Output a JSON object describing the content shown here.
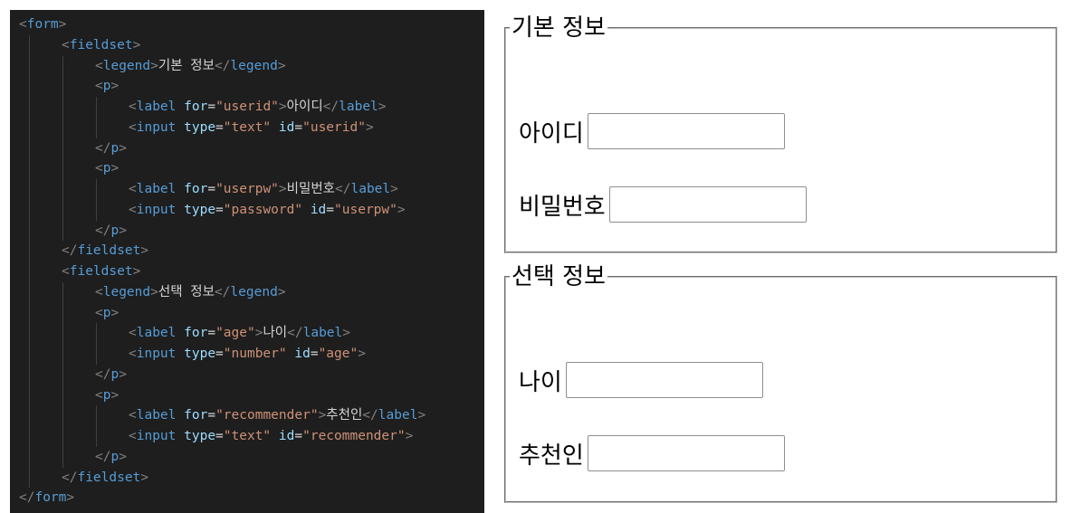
{
  "code": {
    "lines": [
      {
        "indent": 0,
        "segments": [
          {
            "cls": "p",
            "text": "<"
          },
          {
            "cls": "t",
            "text": "form"
          },
          {
            "cls": "p",
            "text": ">"
          }
        ]
      },
      {
        "indent": 1,
        "segments": [
          {
            "cls": "p",
            "text": "<"
          },
          {
            "cls": "t",
            "text": "fieldset"
          },
          {
            "cls": "p",
            "text": ">"
          }
        ]
      },
      {
        "indent": 2,
        "segments": [
          {
            "cls": "p",
            "text": "<"
          },
          {
            "cls": "t",
            "text": "legend"
          },
          {
            "cls": "p",
            "text": ">"
          },
          {
            "cls": "c",
            "text": "기본 정보"
          },
          {
            "cls": "p",
            "text": "</"
          },
          {
            "cls": "t",
            "text": "legend"
          },
          {
            "cls": "p",
            "text": ">"
          }
        ]
      },
      {
        "indent": 2,
        "segments": [
          {
            "cls": "p",
            "text": "<"
          },
          {
            "cls": "t",
            "text": "p"
          },
          {
            "cls": "p",
            "text": ">"
          }
        ]
      },
      {
        "indent": 3,
        "segments": [
          {
            "cls": "p",
            "text": "<"
          },
          {
            "cls": "t",
            "text": "label"
          },
          {
            "cls": "c",
            "text": " "
          },
          {
            "cls": "a",
            "text": "for"
          },
          {
            "cls": "c",
            "text": "="
          },
          {
            "cls": "s",
            "text": "\"userid\""
          },
          {
            "cls": "p",
            "text": ">"
          },
          {
            "cls": "c",
            "text": "아이디"
          },
          {
            "cls": "p",
            "text": "</"
          },
          {
            "cls": "t",
            "text": "label"
          },
          {
            "cls": "p",
            "text": ">"
          }
        ]
      },
      {
        "indent": 3,
        "segments": [
          {
            "cls": "p",
            "text": "<"
          },
          {
            "cls": "t",
            "text": "input"
          },
          {
            "cls": "c",
            "text": " "
          },
          {
            "cls": "a",
            "text": "type"
          },
          {
            "cls": "c",
            "text": "="
          },
          {
            "cls": "s",
            "text": "\"text\""
          },
          {
            "cls": "c",
            "text": " "
          },
          {
            "cls": "a",
            "text": "id"
          },
          {
            "cls": "c",
            "text": "="
          },
          {
            "cls": "s",
            "text": "\"userid\""
          },
          {
            "cls": "p",
            "text": ">"
          }
        ]
      },
      {
        "indent": 2,
        "segments": [
          {
            "cls": "p",
            "text": "</"
          },
          {
            "cls": "t",
            "text": "p"
          },
          {
            "cls": "p",
            "text": ">"
          }
        ]
      },
      {
        "indent": 2,
        "segments": [
          {
            "cls": "p",
            "text": "<"
          },
          {
            "cls": "t",
            "text": "p"
          },
          {
            "cls": "p",
            "text": ">"
          }
        ]
      },
      {
        "indent": 3,
        "segments": [
          {
            "cls": "p",
            "text": "<"
          },
          {
            "cls": "t",
            "text": "label"
          },
          {
            "cls": "c",
            "text": " "
          },
          {
            "cls": "a",
            "text": "for"
          },
          {
            "cls": "c",
            "text": "="
          },
          {
            "cls": "s",
            "text": "\"userpw\""
          },
          {
            "cls": "p",
            "text": ">"
          },
          {
            "cls": "c",
            "text": "비밀번호"
          },
          {
            "cls": "p",
            "text": "</"
          },
          {
            "cls": "t",
            "text": "label"
          },
          {
            "cls": "p",
            "text": ">"
          }
        ]
      },
      {
        "indent": 3,
        "segments": [
          {
            "cls": "p",
            "text": "<"
          },
          {
            "cls": "t",
            "text": "input"
          },
          {
            "cls": "c",
            "text": " "
          },
          {
            "cls": "a",
            "text": "type"
          },
          {
            "cls": "c",
            "text": "="
          },
          {
            "cls": "s",
            "text": "\"password\""
          },
          {
            "cls": "c",
            "text": " "
          },
          {
            "cls": "a",
            "text": "id"
          },
          {
            "cls": "c",
            "text": "="
          },
          {
            "cls": "s",
            "text": "\"userpw\""
          },
          {
            "cls": "p",
            "text": ">"
          }
        ]
      },
      {
        "indent": 2,
        "segments": [
          {
            "cls": "p",
            "text": "</"
          },
          {
            "cls": "t",
            "text": "p"
          },
          {
            "cls": "p",
            "text": ">"
          }
        ]
      },
      {
        "indent": 1,
        "segments": [
          {
            "cls": "p",
            "text": "</"
          },
          {
            "cls": "t",
            "text": "fieldset"
          },
          {
            "cls": "p",
            "text": ">"
          }
        ]
      },
      {
        "indent": 1,
        "segments": [
          {
            "cls": "p",
            "text": "<"
          },
          {
            "cls": "t",
            "text": "fieldset"
          },
          {
            "cls": "p",
            "text": ">"
          }
        ]
      },
      {
        "indent": 2,
        "segments": [
          {
            "cls": "p",
            "text": "<"
          },
          {
            "cls": "t",
            "text": "legend"
          },
          {
            "cls": "p",
            "text": ">"
          },
          {
            "cls": "c",
            "text": "선택 정보"
          },
          {
            "cls": "p",
            "text": "</"
          },
          {
            "cls": "t",
            "text": "legend"
          },
          {
            "cls": "p",
            "text": ">"
          }
        ]
      },
      {
        "indent": 2,
        "segments": [
          {
            "cls": "p",
            "text": "<"
          },
          {
            "cls": "t",
            "text": "p"
          },
          {
            "cls": "p",
            "text": ">"
          }
        ]
      },
      {
        "indent": 3,
        "segments": [
          {
            "cls": "p",
            "text": "<"
          },
          {
            "cls": "t",
            "text": "label"
          },
          {
            "cls": "c",
            "text": " "
          },
          {
            "cls": "a",
            "text": "for"
          },
          {
            "cls": "c",
            "text": "="
          },
          {
            "cls": "s",
            "text": "\"age\""
          },
          {
            "cls": "p",
            "text": ">"
          },
          {
            "cls": "c",
            "text": "나이"
          },
          {
            "cls": "p",
            "text": "</"
          },
          {
            "cls": "t",
            "text": "label"
          },
          {
            "cls": "p",
            "text": ">"
          }
        ]
      },
      {
        "indent": 3,
        "segments": [
          {
            "cls": "p",
            "text": "<"
          },
          {
            "cls": "t",
            "text": "input"
          },
          {
            "cls": "c",
            "text": " "
          },
          {
            "cls": "a",
            "text": "type"
          },
          {
            "cls": "c",
            "text": "="
          },
          {
            "cls": "s",
            "text": "\"number\""
          },
          {
            "cls": "c",
            "text": " "
          },
          {
            "cls": "a",
            "text": "id"
          },
          {
            "cls": "c",
            "text": "="
          },
          {
            "cls": "s",
            "text": "\"age\""
          },
          {
            "cls": "p",
            "text": ">"
          }
        ]
      },
      {
        "indent": 2,
        "segments": [
          {
            "cls": "p",
            "text": "</"
          },
          {
            "cls": "t",
            "text": "p"
          },
          {
            "cls": "p",
            "text": ">"
          }
        ]
      },
      {
        "indent": 2,
        "segments": [
          {
            "cls": "p",
            "text": "<"
          },
          {
            "cls": "t",
            "text": "p"
          },
          {
            "cls": "p",
            "text": ">"
          }
        ]
      },
      {
        "indent": 3,
        "segments": [
          {
            "cls": "p",
            "text": "<"
          },
          {
            "cls": "t",
            "text": "label"
          },
          {
            "cls": "c",
            "text": " "
          },
          {
            "cls": "a",
            "text": "for"
          },
          {
            "cls": "c",
            "text": "="
          },
          {
            "cls": "s",
            "text": "\"recommender\""
          },
          {
            "cls": "p",
            "text": ">"
          },
          {
            "cls": "c",
            "text": "추천인"
          },
          {
            "cls": "p",
            "text": "</"
          },
          {
            "cls": "t",
            "text": "label"
          },
          {
            "cls": "p",
            "text": ">"
          }
        ]
      },
      {
        "indent": 3,
        "segments": [
          {
            "cls": "p",
            "text": "<"
          },
          {
            "cls": "t",
            "text": "input"
          },
          {
            "cls": "c",
            "text": " "
          },
          {
            "cls": "a",
            "text": "type"
          },
          {
            "cls": "c",
            "text": "="
          },
          {
            "cls": "s",
            "text": "\"text\""
          },
          {
            "cls": "c",
            "text": " "
          },
          {
            "cls": "a",
            "text": "id"
          },
          {
            "cls": "c",
            "text": "="
          },
          {
            "cls": "s",
            "text": "\"recommender\""
          },
          {
            "cls": "p",
            "text": ">"
          }
        ]
      },
      {
        "indent": 2,
        "segments": [
          {
            "cls": "p",
            "text": "</"
          },
          {
            "cls": "t",
            "text": "p"
          },
          {
            "cls": "p",
            "text": ">"
          }
        ]
      },
      {
        "indent": 1,
        "segments": [
          {
            "cls": "p",
            "text": "</"
          },
          {
            "cls": "t",
            "text": "fieldset"
          },
          {
            "cls": "p",
            "text": ">"
          }
        ]
      },
      {
        "indent": 0,
        "segments": [
          {
            "cls": "p",
            "text": "</"
          },
          {
            "cls": "t",
            "text": "form"
          },
          {
            "cls": "p",
            "text": ">"
          }
        ]
      }
    ]
  },
  "form": {
    "basic": {
      "legend": "기본 정보",
      "userid": {
        "label": "아이디",
        "value": ""
      },
      "userpw": {
        "label": "비밀번호",
        "value": ""
      }
    },
    "optional": {
      "legend": "선택 정보",
      "age": {
        "label": "나이",
        "value": ""
      },
      "recommender": {
        "label": "추천인",
        "value": ""
      }
    }
  },
  "colors": {
    "editor_bg": "#1e1e1e",
    "tag": "#569cd6",
    "attribute": "#9cdcfe",
    "string": "#ce9178",
    "punctuation": "#808080",
    "text": "#d4d4d4"
  }
}
